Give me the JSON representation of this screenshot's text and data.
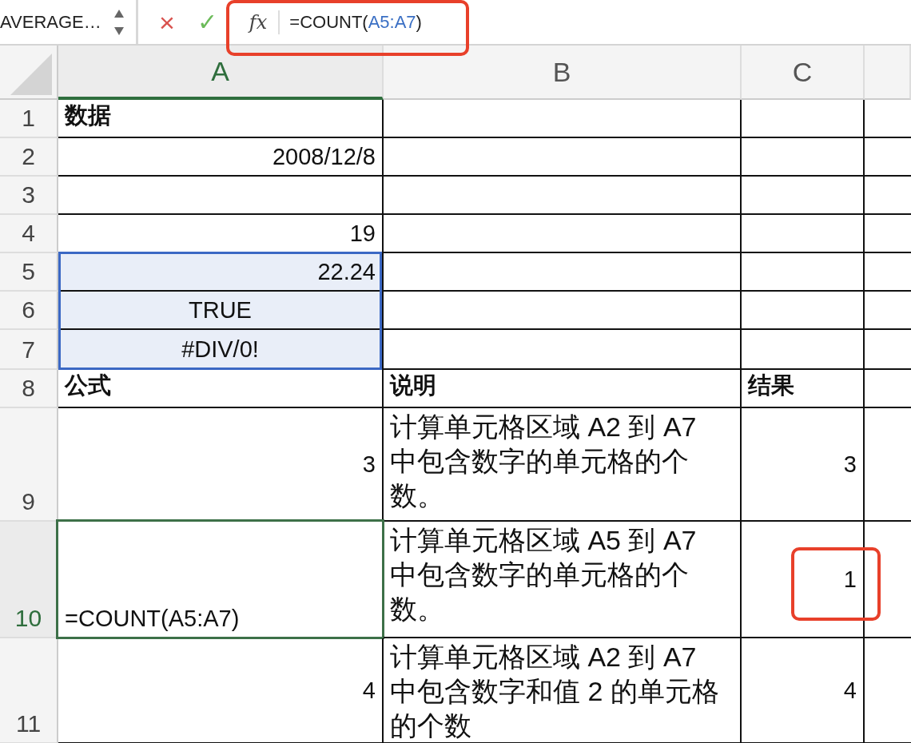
{
  "formula_bar": {
    "name_box": "AVERAGE…",
    "cancel_label": "×",
    "enter_label": "✓",
    "function_label": "fx",
    "highlighted": true,
    "formula": [
      {
        "text": "=COUNT(",
        "kind": "plain"
      },
      {
        "text": "A5:A7",
        "kind": "reference"
      },
      {
        "text": ")",
        "kind": "plain"
      }
    ]
  },
  "columns": [
    {
      "label": "A",
      "selected": true
    },
    {
      "label": "B",
      "selected": false
    },
    {
      "label": "C",
      "selected": false
    },
    {
      "selected": false
    }
  ],
  "rows": [
    {
      "header": "1",
      "selected": false,
      "cells": [
        {
          "text": "数据",
          "kind": "heading",
          "selected": false,
          "active": false
        },
        {
          "selected": false,
          "active": false
        },
        {
          "selected": false,
          "active": false
        }
      ]
    },
    {
      "header": "2",
      "selected": false,
      "cells": [
        {
          "text": "2008/12/8",
          "kind": "number",
          "selected": false,
          "active": false
        },
        {
          "selected": false,
          "active": false
        },
        {
          "selected": false,
          "active": false
        }
      ]
    },
    {
      "header": "3",
      "selected": false,
      "cells": [
        {
          "selected": false,
          "active": false
        },
        {
          "selected": false,
          "active": false
        },
        {
          "selected": false,
          "active": false
        }
      ]
    },
    {
      "header": "4",
      "selected": false,
      "cells": [
        {
          "text": "19",
          "kind": "number",
          "selected": false,
          "active": false
        },
        {
          "selected": false,
          "active": false
        },
        {
          "selected": false,
          "active": false
        }
      ]
    },
    {
      "header": "5",
      "selected": false,
      "cells": [
        {
          "text": "22.24",
          "kind": "number",
          "selected": true,
          "active": false
        },
        {
          "selected": false,
          "active": false
        },
        {
          "selected": false,
          "active": false
        }
      ]
    },
    {
      "header": "6",
      "selected": false,
      "cells": [
        {
          "text": "TRUE",
          "kind": "logical",
          "selected": true,
          "active": false
        },
        {
          "selected": false,
          "active": false
        },
        {
          "selected": false,
          "active": false
        }
      ]
    },
    {
      "header": "7",
      "selected": false,
      "cells": [
        {
          "text": "#DIV/0!",
          "kind": "error",
          "selected": true,
          "active": false
        },
        {
          "selected": false,
          "active": false
        },
        {
          "selected": false,
          "active": false
        }
      ]
    },
    {
      "header": "8",
      "selected": false,
      "cells": [
        {
          "text": "公式",
          "kind": "heading",
          "selected": false,
          "active": false
        },
        {
          "text": "说明",
          "kind": "heading",
          "selected": false,
          "active": false
        },
        {
          "text": "结果",
          "kind": "heading",
          "selected": false,
          "active": false
        }
      ]
    },
    {
      "header": "9",
      "selected": false,
      "cells": [
        {
          "text": "3",
          "kind": "number",
          "selected": false,
          "active": false
        },
        {
          "text": "计算单元格区域 A2 到 A7 中包含数字的单元格的个数。",
          "kind": "text",
          "selected": false,
          "active": false
        },
        {
          "text": "3",
          "kind": "number",
          "selected": false,
          "active": false
        }
      ]
    },
    {
      "header": "10",
      "selected": true,
      "cells": [
        {
          "text": "=COUNT(A5:A7)",
          "kind": "formula",
          "selected": false,
          "active": true
        },
        {
          "text": "计算单元格区域 A5 到 A7 中包含数字的单元格的个数。",
          "kind": "text",
          "selected": false,
          "active": false
        },
        {
          "text": "1",
          "kind": "number",
          "selected": false,
          "active": false,
          "highlighted": true
        }
      ]
    },
    {
      "header": "11",
      "selected": false,
      "cells": [
        {
          "text": "4",
          "kind": "number",
          "selected": false,
          "active": false
        },
        {
          "text": "计算单元格区域 A2 到 A7 中包含数字和值 2 的单元格的个数",
          "kind": "text",
          "selected": false,
          "active": false
        },
        {
          "text": "4",
          "kind": "number",
          "selected": false,
          "active": false
        }
      ]
    }
  ]
}
